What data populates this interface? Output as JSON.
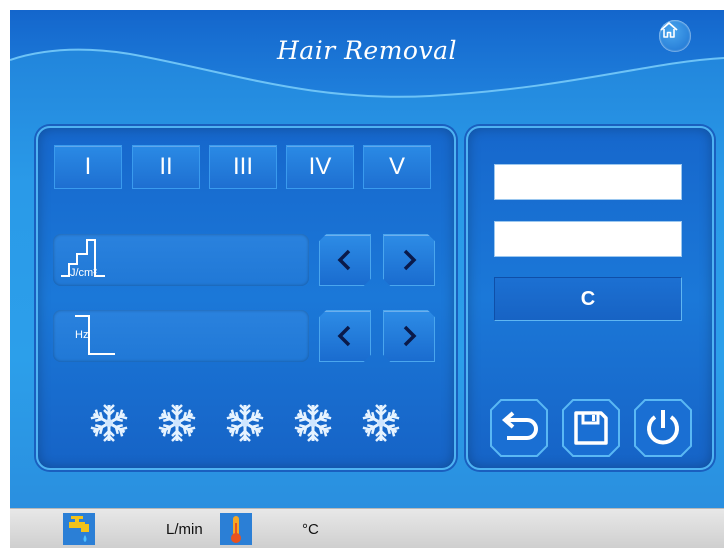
{
  "header": {
    "title": "Hair Removal",
    "home_icon": "home-icon"
  },
  "levels": [
    "I",
    "II",
    "III",
    "IV",
    "V"
  ],
  "selected_level": null,
  "energy": {
    "unit": "J/cm²",
    "icon": "energy-step-icon",
    "value": ""
  },
  "frequency": {
    "unit": "Hz",
    "icon": "frequency-pulse-icon",
    "value": ""
  },
  "arrows": {
    "decrease_icon": "chevron-left-icon",
    "increase_icon": "chevron-right-icon"
  },
  "cooling": {
    "icon": "snowflake-icon",
    "count": 5
  },
  "right_panel": {
    "field1": "",
    "field2": "",
    "mode_label": "C"
  },
  "actions": {
    "back_icon": "undo-icon",
    "save_icon": "save-icon",
    "power_icon": "power-icon"
  },
  "status": {
    "water_icon": "water-tap-icon",
    "flow_value": "",
    "flow_unit": "L/min",
    "temp_icon": "thermometer-icon",
    "temp_value": "",
    "temp_unit": "°C"
  },
  "colors": {
    "background": "#2a9ae8",
    "panel": "#1b78d8",
    "button": "#2a8ae5",
    "accent_border": "#4fb3f2",
    "text": "#ffffff"
  }
}
